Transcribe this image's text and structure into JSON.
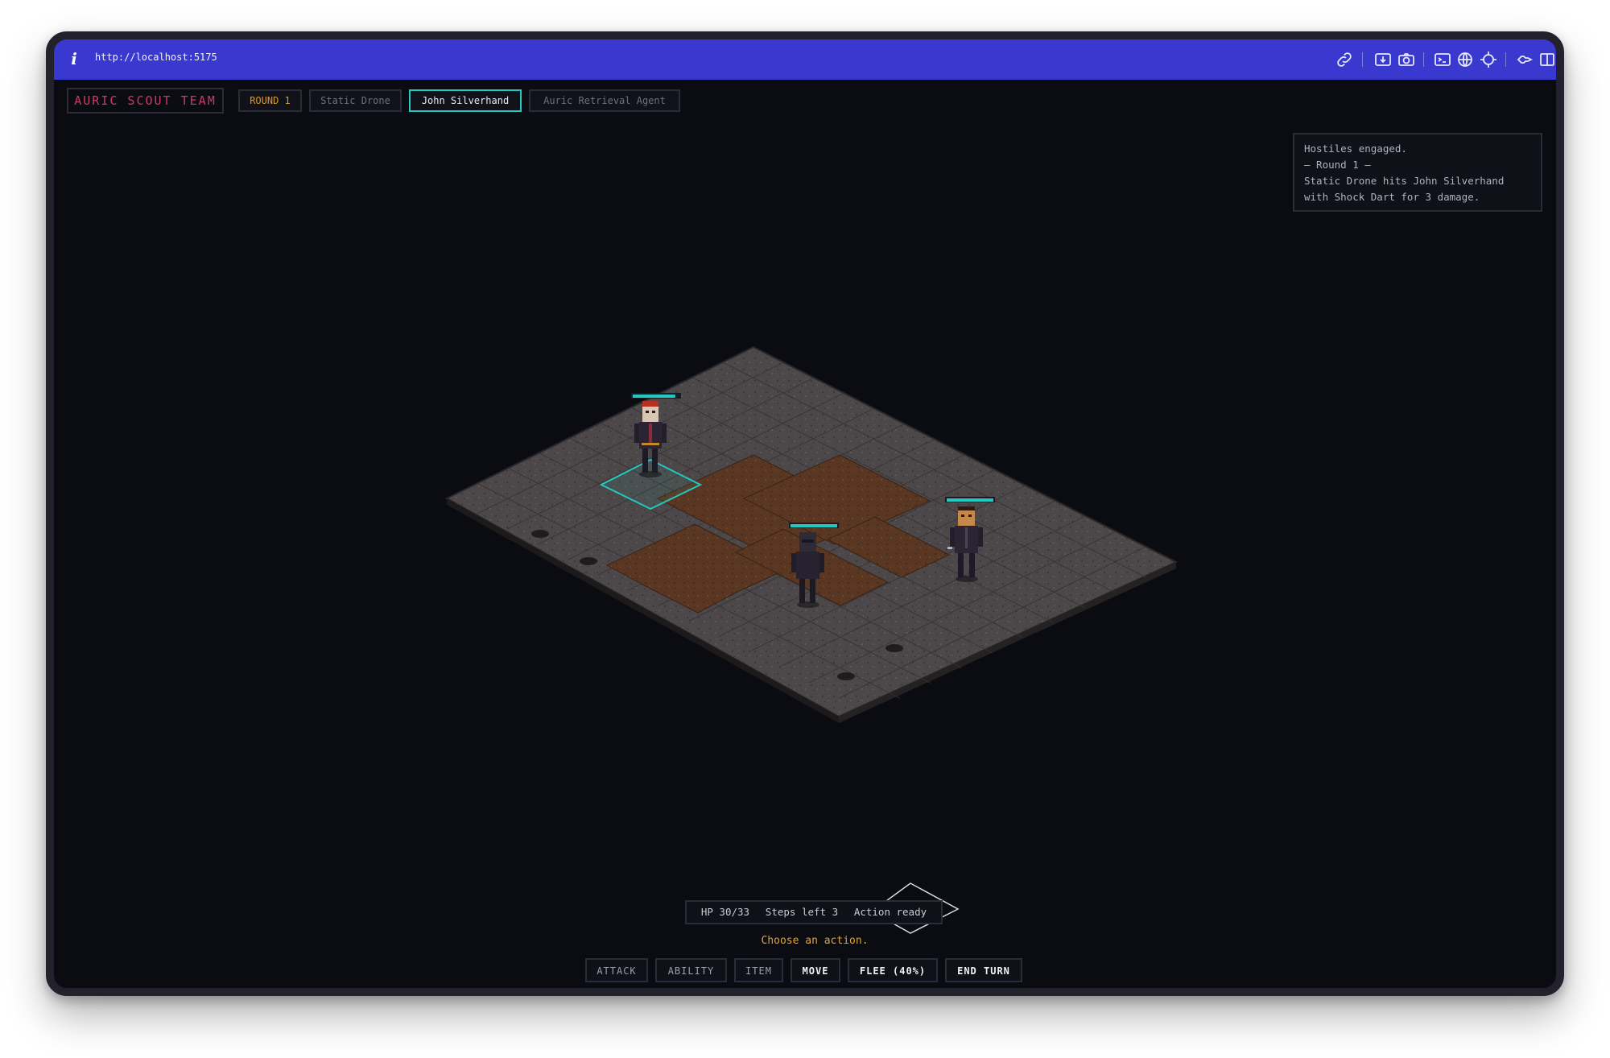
{
  "browser": {
    "url": "http://localhost:5175",
    "info_label": "i",
    "toolbar_icons": [
      "link-icon",
      "screenshot-icon",
      "camera-icon",
      "terminal-icon",
      "globe-icon",
      "crosshair-icon",
      "extension-icon",
      "split-view-icon"
    ]
  },
  "hud": {
    "team": "AURIC SCOUT TEAM",
    "round": "ROUND 1",
    "turn_order": [
      "Static Drone",
      "John Silverhand",
      "Auric Retrieval Agent"
    ],
    "active_turn": "John Silverhand"
  },
  "combat_log": [
    "Hostiles engaged.",
    "— Round 1 —",
    "Static Drone hits John Silverhand",
    "with Shock Dart for 3 damage."
  ],
  "status": {
    "hp": "HP 30/33",
    "steps": "Steps left 3",
    "action": "Action ready"
  },
  "prompt": "Choose an action.",
  "actions": [
    "ATTACK",
    "ABILITY",
    "ITEM",
    "MOVE",
    "FLEE (40%)",
    "END TURN"
  ],
  "units": [
    {
      "role": "player",
      "hp_fraction": 0.91
    },
    {
      "role": "enemy",
      "hp_fraction": 1.0
    },
    {
      "role": "enemy",
      "hp_fraction": 1.0
    }
  ],
  "colors": {
    "topbar": "#3a39cf",
    "background": "#0b0c12",
    "accent_cyan": "#23c8c1",
    "team_red": "#c93a66",
    "round_gold": "#d59a30",
    "floor_stone": "#4c4748",
    "floor_dirt": "#5a3722"
  }
}
